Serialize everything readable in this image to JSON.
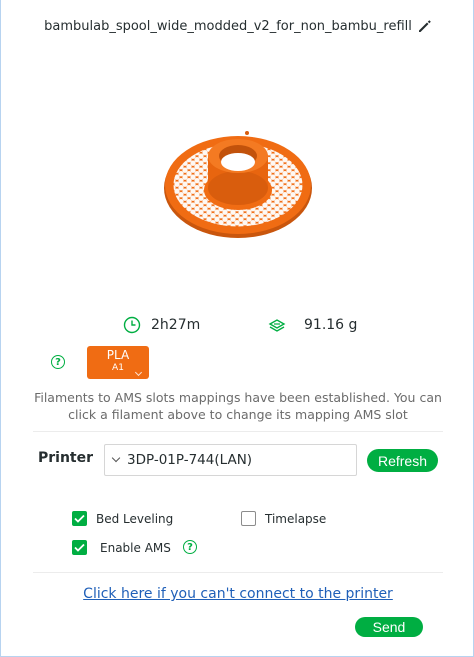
{
  "model": {
    "name": "bambulab_spool_wide_modded_v2_for_non_bambu_refill"
  },
  "stats": {
    "print_time": "2h27m",
    "weight": "91.16 g"
  },
  "filament": {
    "type": "PLA",
    "slot": "A1",
    "color": "#f06c13"
  },
  "mapping_note": "Filaments to AMS slots mappings have been established. You can click a filament above to change its mapping AMS slot",
  "printer": {
    "label": "Printer",
    "selected": "3DP-01P-744(LAN)",
    "refresh_label": "Refresh"
  },
  "options": {
    "bed_leveling": {
      "label": "Bed Leveling",
      "checked": true
    },
    "timelapse": {
      "label": "Timelapse",
      "checked": false
    },
    "enable_ams": {
      "label": "Enable AMS",
      "checked": true
    }
  },
  "connect_link": "Click here if you can't connect to the printer",
  "send_label": "Send",
  "colors": {
    "accent": "#00ae42",
    "filament": "#f06c13",
    "link": "#1f5fb8"
  }
}
